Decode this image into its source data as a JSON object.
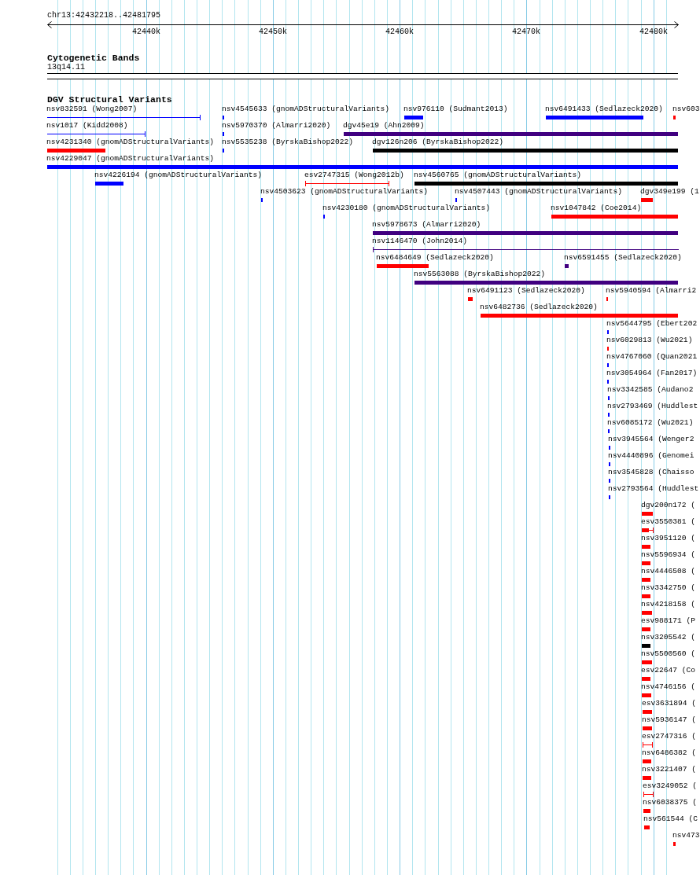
{
  "location": "chr13:42432218..42481795",
  "ruler": {
    "ticks": [
      "42440k",
      "42450k",
      "42460k",
      "42470k",
      "42480k"
    ]
  },
  "cytoband_track": {
    "title": "Cytogenetic Bands",
    "band": "13q14.11"
  },
  "variant_track": {
    "title": "DGV Structural Variants",
    "features": [
      {
        "label": "nsv832591 (Wong2007)",
        "kind": "span",
        "color": "#0000ff"
      },
      {
        "label": "nsv4545633 (gnomADStructuralVariants)",
        "kind": "block",
        "color": "#0000ff"
      },
      {
        "label": "nsv976110 (Sudmant2013)",
        "kind": "block",
        "color": "#0000ff"
      },
      {
        "label": "nsv6491433 (Sedlazeck2020)",
        "kind": "block",
        "color": "#0000ff"
      },
      {
        "label": "nsv603",
        "kind": "block",
        "color": "#ff0000"
      },
      {
        "label": "nsv1017 (Kidd2008)",
        "kind": "span",
        "color": "#0000ff"
      },
      {
        "label": "nsv5970370 (Almarri2020)",
        "kind": "block",
        "color": "#0000ff"
      },
      {
        "label": "dgv45e19 (Ahn2009)",
        "kind": "block",
        "color": "#400080"
      },
      {
        "label": "nsv4231340 (gnomADStructuralVariants)",
        "kind": "block",
        "color": "#ff0000"
      },
      {
        "label": "nsv5535238 (ByrskaBishop2022)",
        "kind": "block",
        "color": "#0000ff"
      },
      {
        "label": "dgv126n206 (ByrskaBishop2022)",
        "kind": "block",
        "color": "#000000"
      },
      {
        "label": "nsv4229047 (gnomADStructuralVariants)",
        "kind": "block",
        "color": "#0000ff"
      },
      {
        "label": "nsv4226194 (gnomADStructuralVariants)",
        "kind": "block",
        "color": "#0000ff"
      },
      {
        "label": "esv2747315 (Wong2012b)",
        "kind": "span",
        "color": "#ff0000"
      },
      {
        "label": "nsv4560765 (gnomADStructuralVariants)",
        "kind": "block",
        "color": "#000000"
      },
      {
        "label": "nsv4503623 (gnomADStructuralVariants)",
        "kind": "block",
        "color": "#0000ff"
      },
      {
        "label": "nsv4507443 (gnomADStructuralVariants)",
        "kind": "block",
        "color": "#0000ff"
      },
      {
        "label": "dgv349e199 (1",
        "kind": "block",
        "color": "#ff0000"
      },
      {
        "label": "nsv4230180 (gnomADStructuralVariants)",
        "kind": "block",
        "color": "#0000ff"
      },
      {
        "label": "nsv1047842 (Coe2014)",
        "kind": "block",
        "color": "#ff0000"
      },
      {
        "label": "nsv5978673 (Almarri2020)",
        "kind": "block",
        "color": "#400080"
      },
      {
        "label": "nsv1146470 (John2014)",
        "kind": "span",
        "color": "#400080"
      },
      {
        "label": "nsv6484649 (Sedlazeck2020)",
        "kind": "block",
        "color": "#ff0000"
      },
      {
        "label": "nsv6591455 (Sedlazeck2020)",
        "kind": "block",
        "color": "#400080"
      },
      {
        "label": "nsv5563088 (ByrskaBishop2022)",
        "kind": "block",
        "color": "#400080"
      },
      {
        "label": "nsv6491123 (Sedlazeck2020)",
        "kind": "block",
        "color": "#ff0000"
      },
      {
        "label": "nsv5940594 (Almarri2",
        "kind": "block",
        "color": "#ff0000"
      },
      {
        "label": "nsv6482736 (Sedlazeck2020)",
        "kind": "block",
        "color": "#ff0000"
      },
      {
        "label": "nsv5644795 (Ebert202",
        "kind": "block",
        "color": "#0000ff"
      },
      {
        "label": "nsv6029813 (Wu2021)",
        "kind": "block",
        "color": "#ff0000"
      },
      {
        "label": "nsv4767060 (Quan2021",
        "kind": "block",
        "color": "#0000ff"
      },
      {
        "label": "nsv3054964 (Fan2017)",
        "kind": "block",
        "color": "#0000ff"
      },
      {
        "label": "nsv3342585 (Audano2",
        "kind": "block",
        "color": "#0000ff"
      },
      {
        "label": "nsv2793469 (Huddlest",
        "kind": "block",
        "color": "#0000ff"
      },
      {
        "label": "nsv6085172 (Wu2021)",
        "kind": "block",
        "color": "#0000ff"
      },
      {
        "label": "nsv3945564 (Wenger2",
        "kind": "block",
        "color": "#0000ff"
      },
      {
        "label": "nsv4440896 (Genomei",
        "kind": "block",
        "color": "#0000ff"
      },
      {
        "label": "nsv3545828 (Chaisso",
        "kind": "block",
        "color": "#0000ff"
      },
      {
        "label": "nsv2793564 (Huddlest",
        "kind": "block",
        "color": "#0000ff"
      },
      {
        "label": "dgv200n172 (",
        "kind": "block",
        "color": "#ff0000"
      },
      {
        "label": "esv3550381 (",
        "kind": "block-span",
        "color": "#ff0000"
      },
      {
        "label": "nsv3951120 (",
        "kind": "block",
        "color": "#ff0000"
      },
      {
        "label": "nsv5596934 (",
        "kind": "block",
        "color": "#ff0000"
      },
      {
        "label": "nsv4446508 (",
        "kind": "block",
        "color": "#ff0000"
      },
      {
        "label": "nsv3342750 (",
        "kind": "block",
        "color": "#ff0000"
      },
      {
        "label": "nsv4218158 (",
        "kind": "block",
        "color": "#ff0000"
      },
      {
        "label": "esv988171 (P",
        "kind": "block",
        "color": "#ff0000"
      },
      {
        "label": "nsv3205542 (",
        "kind": "block",
        "color": "#000000"
      },
      {
        "label": "nsv5500560 (",
        "kind": "block",
        "color": "#ff0000"
      },
      {
        "label": "esv22647 (Co",
        "kind": "block",
        "color": "#ff0000"
      },
      {
        "label": "nsv4746156 (",
        "kind": "block",
        "color": "#ff0000"
      },
      {
        "label": "esv3631894 (",
        "kind": "block",
        "color": "#ff0000"
      },
      {
        "label": "nsv5936147 (",
        "kind": "block",
        "color": "#ff0000"
      },
      {
        "label": "esv2747316 (",
        "kind": "span",
        "color": "#ff0000"
      },
      {
        "label": "nsv6486382 (",
        "kind": "block",
        "color": "#ff0000"
      },
      {
        "label": "nsv3221407 (",
        "kind": "block",
        "color": "#ff0000"
      },
      {
        "label": "esv3249052 (",
        "kind": "span",
        "color": "#ff0000"
      },
      {
        "label": "nsv6038375 (",
        "kind": "block",
        "color": "#ff0000"
      },
      {
        "label": "nsv561544 (C",
        "kind": "block",
        "color": "#ff0000"
      },
      {
        "label": "nsv473",
        "kind": "block",
        "color": "#ff0000"
      }
    ]
  }
}
